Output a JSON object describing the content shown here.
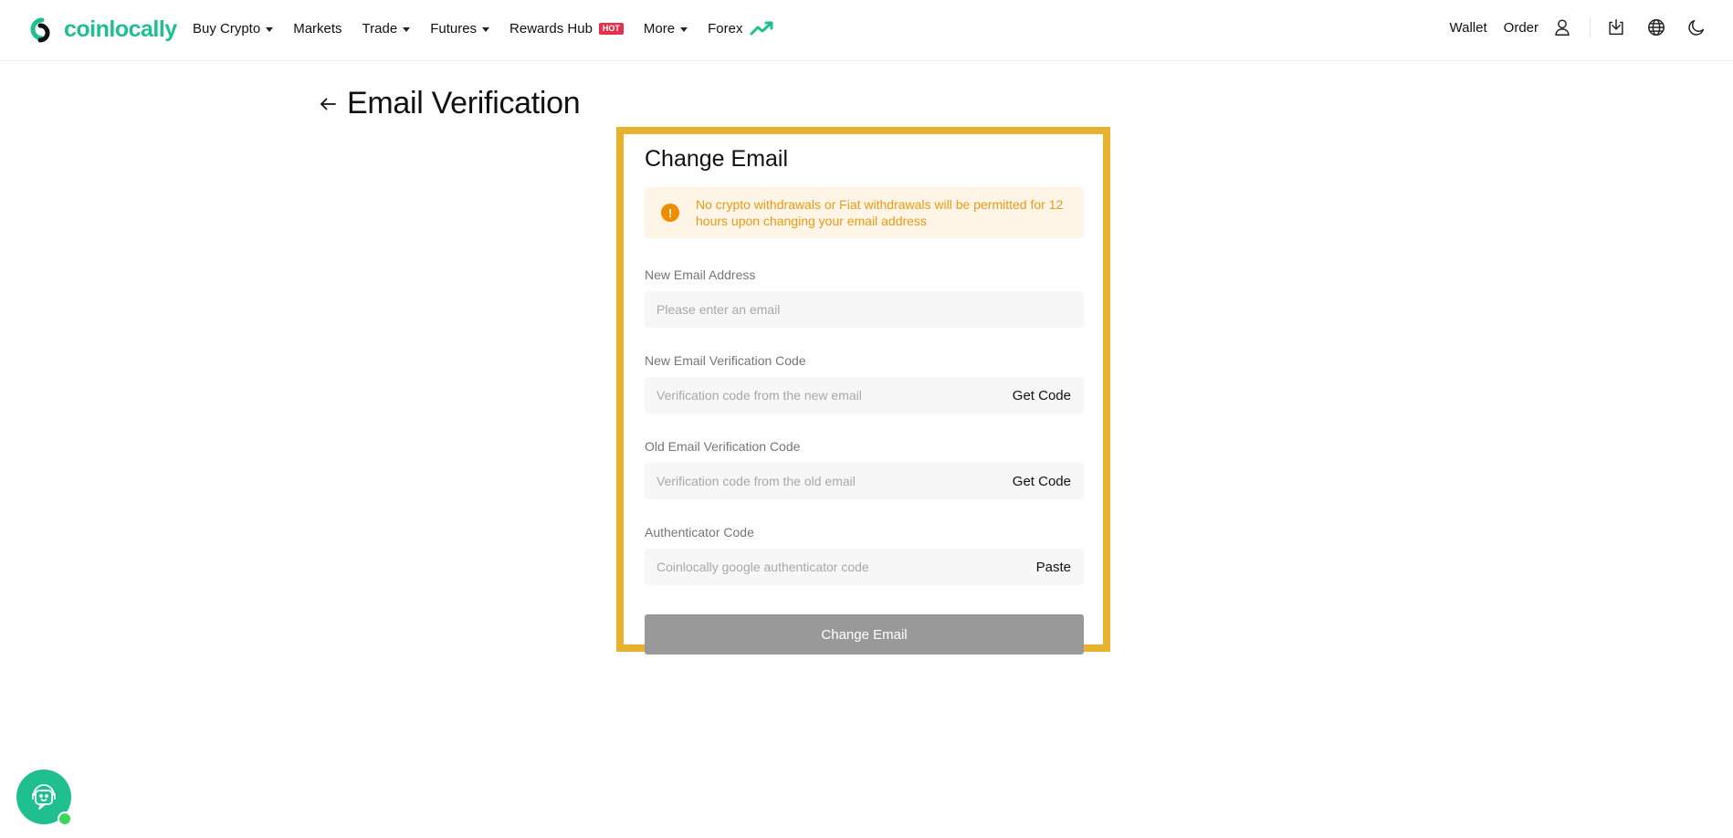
{
  "brand": {
    "name": "coinlocally",
    "color": "#1fbf8f"
  },
  "nav": {
    "items": [
      {
        "label": "Buy Crypto",
        "dropdown": true
      },
      {
        "label": "Markets",
        "dropdown": false
      },
      {
        "label": "Trade",
        "dropdown": true
      },
      {
        "label": "Futures",
        "dropdown": true
      },
      {
        "label": "Rewards Hub",
        "badge": "HOT"
      },
      {
        "label": "More",
        "dropdown": true
      },
      {
        "label": "Forex",
        "icon": "trend-up-icon"
      }
    ]
  },
  "header_right": {
    "wallet": "Wallet",
    "order": "Order",
    "icons": [
      "user-icon",
      "download-icon",
      "globe-icon",
      "moon-icon"
    ]
  },
  "page": {
    "title": "Email Verification",
    "back_icon": "arrow-left-icon"
  },
  "form": {
    "title": "Change Email",
    "notice": "No crypto withdrawals or Fiat withdrawals will be permitted for 12 hours upon changing your email address",
    "notice_color": "#ec9a15",
    "fields": [
      {
        "label": "New Email Address",
        "placeholder": "Please enter an email",
        "value": "",
        "action": ""
      },
      {
        "label": "New Email Verification Code",
        "placeholder": "Verification code from the new email",
        "value": "",
        "action": "Get Code"
      },
      {
        "label": "Old Email Verification Code",
        "placeholder": "Verification code from the old email",
        "value": "",
        "action": "Get Code"
      },
      {
        "label": "Authenticator Code",
        "placeholder": "Coinlocally google authenticator code",
        "value": "",
        "action": "Paste"
      }
    ],
    "submit_label": "Change Email",
    "submit_color": "#999999",
    "highlight_color": "#e8b22f"
  },
  "support": {
    "icon": "support-chat-icon",
    "status": "online"
  }
}
